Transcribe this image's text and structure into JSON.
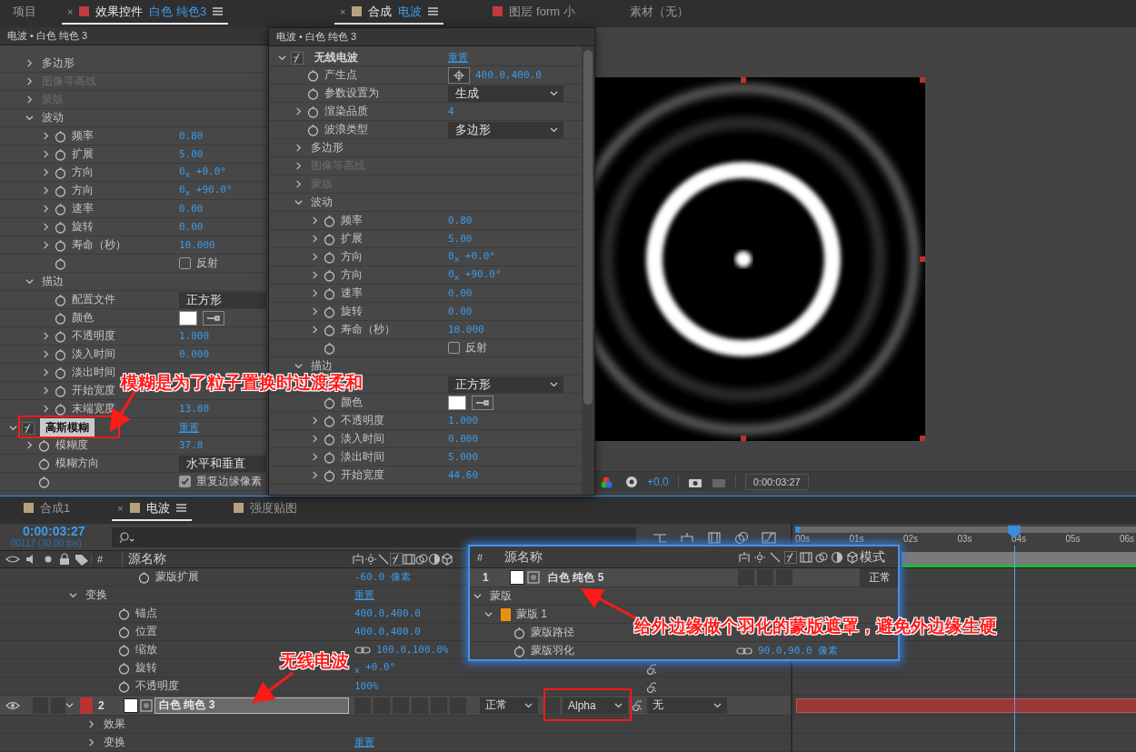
{
  "effect_controls": {
    "tabs": [
      {
        "label": "项目",
        "selected": false
      },
      {
        "label": "效果控件",
        "target": "白色 纯色3",
        "color": "#c23b3b",
        "close": "×",
        "selected": true
      }
    ],
    "breadcrumb": "电波 • 白色 纯色 3",
    "rows": [
      {
        "kind": "group",
        "label": "多边形",
        "expanded": false,
        "disabled": false
      },
      {
        "kind": "group",
        "label": "图像等高线",
        "expanded": false,
        "disabled": true
      },
      {
        "kind": "group",
        "label": "蒙版",
        "expanded": false,
        "disabled": true
      },
      {
        "kind": "group",
        "label": "波动",
        "expanded": true,
        "disabled": false,
        "children": [
          {
            "kind": "number",
            "label": "频率",
            "value": "0.80"
          },
          {
            "kind": "number",
            "label": "扩展",
            "value": "5.00"
          },
          {
            "kind": "number",
            "label": "方向",
            "value": "0$_{x}$ +0.0°"
          },
          {
            "kind": "number",
            "label": "方向",
            "value": "0$_{x}$ +90.0°"
          },
          {
            "kind": "number",
            "label": "速率",
            "value": "0.00"
          },
          {
            "kind": "number",
            "label": "旋转",
            "value": "0.00"
          },
          {
            "kind": "number",
            "label": "寿命（秒）",
            "value": "10.000"
          },
          {
            "kind": "checkbox",
            "value": "反射",
            "checked": false
          }
        ]
      },
      {
        "kind": "group",
        "label": "描边",
        "expanded": true,
        "disabled": false,
        "children": [
          {
            "kind": "dropdown",
            "label": "配置文件",
            "value": "正方形"
          },
          {
            "kind": "color",
            "label": "颜色"
          },
          {
            "kind": "number",
            "label": "不透明度",
            "value": "1.000"
          },
          {
            "kind": "number",
            "label": "淡入时间",
            "value": "0.000"
          },
          {
            "kind": "number",
            "label": "淡出时间"
          },
          {
            "kind": "number",
            "label": "开始宽度"
          },
          {
            "kind": "number",
            "label": "末端宽度",
            "value": "13.80"
          }
        ]
      },
      {
        "kind": "effect",
        "label": "高斯模糊",
        "link": "重置",
        "expanded": true,
        "selected": true,
        "children": [
          {
            "kind": "number",
            "label": "模糊度",
            "value": "37.8"
          },
          {
            "kind": "dropdown",
            "label": "模糊方向",
            "value": "水平和垂直"
          },
          {
            "kind": "checkbox",
            "value": "重复边缘像素",
            "checked": true
          }
        ]
      }
    ]
  },
  "effect_popup": {
    "breadcrumb": "电波 • 白色 纯色 3",
    "rows": [
      {
        "kind": "effect",
        "label": "无线电波",
        "link": "重置",
        "expanded": true,
        "selected": false,
        "children": [
          {
            "kind": "point",
            "label": "产生点",
            "value": "400.0,400.0"
          },
          {
            "kind": "dropdown",
            "label": "参数设置为",
            "value": "生成"
          },
          {
            "kind": "number",
            "label": "渲染品质",
            "value": "4"
          },
          {
            "kind": "dropdown",
            "label": "波浪类型",
            "value": "多边形"
          },
          {
            "kind": "group",
            "label": "多边形",
            "expanded": false,
            "disabled": false
          },
          {
            "kind": "group",
            "label": "图像等高线",
            "expanded": false,
            "disabled": true
          },
          {
            "kind": "group",
            "label": "蒙版",
            "expanded": false,
            "disabled": true
          },
          {
            "kind": "group",
            "label": "波动",
            "expanded": true,
            "disabled": false,
            "children": [
              {
                "kind": "number",
                "label": "频率",
                "value": "0.80"
              },
              {
                "kind": "number",
                "label": "扩展",
                "value": "5.00"
              },
              {
                "kind": "number",
                "label": "方向",
                "value": "0$_{x}$ +0.0°"
              },
              {
                "kind": "number",
                "label": "方向",
                "value": "0$_{x}$ +90.0°"
              },
              {
                "kind": "number",
                "label": "速率",
                "value": "0.00"
              },
              {
                "kind": "number",
                "label": "旋转",
                "value": "0.00"
              },
              {
                "kind": "number",
                "label": "寿命（秒）",
                "value": "10.000"
              },
              {
                "kind": "checkbox",
                "value": "反射",
                "checked": false
              }
            ]
          },
          {
            "kind": "group",
            "label": "描边",
            "expanded": true,
            "disabled": false,
            "children": [
              {
                "kind": "dropdown",
                "value": "正方形"
              },
              {
                "kind": "color",
                "label": "颜色"
              },
              {
                "kind": "number",
                "label": "不透明度",
                "value": "1.000"
              },
              {
                "kind": "number",
                "label": "淡入时间",
                "value": "0.000"
              },
              {
                "kind": "number",
                "label": "淡出时间",
                "value": "5.000"
              },
              {
                "kind": "number",
                "label": "开始宽度",
                "value": "44.60"
              }
            ]
          }
        ]
      }
    ]
  },
  "viewer": {
    "tabs": [
      {
        "label": "合成",
        "target": "电波",
        "color": "#b5a27c",
        "close": "×",
        "selected": true
      },
      {
        "label": "图层 form 小",
        "color": "#c23b3b",
        "selected": false
      },
      {
        "label": "素材（无）",
        "selected": false
      }
    ],
    "exposure": "+0.0",
    "timecode": "0:00:03:27"
  },
  "timeline": {
    "tabs": [
      {
        "label": "合成1",
        "color": "#b5a27c",
        "selected": false
      },
      {
        "label": "电波",
        "color": "#b5a27c",
        "close": "×",
        "selected": true
      },
      {
        "label": "强度贴图",
        "color": "#b5a27c",
        "selected": false
      }
    ],
    "timecode": "0:00:03:27",
    "frame_info": "00117 (30.00 fps)",
    "columns": [
      "#",
      "源名称"
    ],
    "ruler": [
      "00s",
      "01s",
      "02s",
      "03s",
      "04s",
      "05s",
      "06s"
    ],
    "rows": [
      {
        "kind": "mask_prop",
        "label": "蒙版扩展",
        "value": "-60.0 像素"
      },
      {
        "kind": "group",
        "label": "变换",
        "expanded": true,
        "link": "重置",
        "children": [
          {
            "kind": "prop",
            "label": "锚点",
            "value": "400.0,400.0"
          },
          {
            "kind": "prop",
            "label": "位置",
            "value": "400.0,400.0"
          },
          {
            "kind": "prop",
            "label": "缩放",
            "value": "100.0,100.0%",
            "linked": true
          },
          {
            "kind": "prop",
            "label": "旋转",
            "value": "$_{x}$ +0.0°",
            "pick_whip": true
          },
          {
            "kind": "prop",
            "label": "不透明度",
            "value": "100%",
            "pick_whip": true
          }
        ]
      },
      {
        "kind": "layer",
        "index": "2",
        "name": "白色 纯色 3",
        "color": "#b83434",
        "visible": true,
        "selected": true,
        "expanded": true,
        "mode": "正常",
        "track_matte": "Alpha",
        "parent": "无",
        "children": [
          {
            "kind": "group",
            "label": "效果",
            "expanded": false
          },
          {
            "kind": "group",
            "label": "变换",
            "expanded": false,
            "link": "重置"
          }
        ]
      }
    ]
  },
  "mask_panel": {
    "columns": [
      "#",
      "源名称",
      "模式"
    ],
    "layer": {
      "index": "1",
      "name": "白色 纯色 5",
      "mode": "正常"
    },
    "rows": [
      {
        "kind": "group",
        "label": "蒙版",
        "expanded": true,
        "children": [
          {
            "kind": "mask",
            "label": "蒙版 1",
            "color": "#e8930f",
            "expanded": true,
            "children": [
              {
                "kind": "prop",
                "label": "蒙版路径"
              },
              {
                "kind": "prop",
                "label": "蒙版羽化",
                "value": "90.0,90.0 像素",
                "linked": true
              }
            ]
          }
        ]
      }
    ]
  },
  "annotations": [
    "模糊是为了粒子置换时过渡柔和",
    "给外边缘做个羽化的蒙版遮罩，避免外边缘生硬",
    "无线电波"
  ]
}
